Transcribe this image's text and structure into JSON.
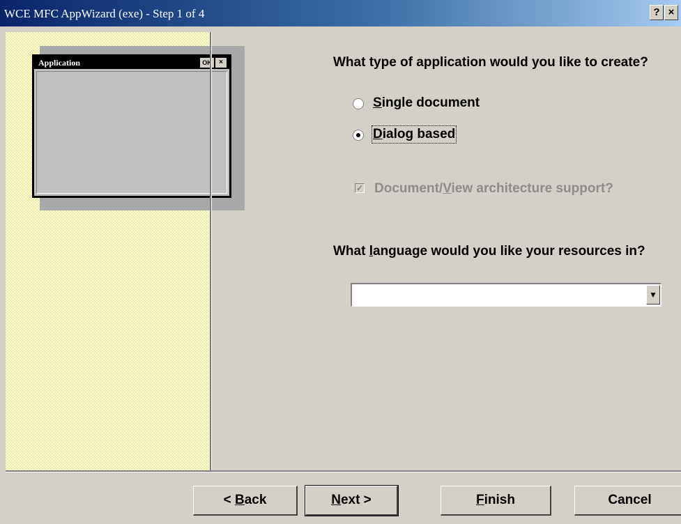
{
  "window": {
    "title": "WCE MFC AppWizard (exe) - Step 1 of 4",
    "help_glyph": "?",
    "close_glyph": "×"
  },
  "preview": {
    "title": "Application",
    "ok": "OK",
    "close": "×"
  },
  "app_type": {
    "question": "What type of application would you like to create?",
    "options": [
      {
        "pre": "",
        "key": "S",
        "post": "ingle document",
        "selected": false
      },
      {
        "pre": "",
        "key": "D",
        "post": "ialog based",
        "selected": true
      }
    ]
  },
  "docview": {
    "pre": "Document/",
    "key": "V",
    "post": "iew architecture support?",
    "checked": true,
    "enabled": false
  },
  "language": {
    "q_pre": "What ",
    "q_key": "l",
    "q_post": "anguage would you like your resources in?",
    "value": "",
    "arrow": "▼"
  },
  "buttons": {
    "back": {
      "pre": "< ",
      "key": "B",
      "post": "ack"
    },
    "next": {
      "pre": "",
      "key": "N",
      "post": "ext >"
    },
    "finish": {
      "pre": "",
      "key": "F",
      "post": "inish"
    },
    "cancel": {
      "label": "Cancel"
    }
  },
  "colors": {
    "title_start": "#0a246a",
    "title_end": "#a6caf0",
    "face": "#d4d0c8",
    "panel": "#ffffcc"
  }
}
